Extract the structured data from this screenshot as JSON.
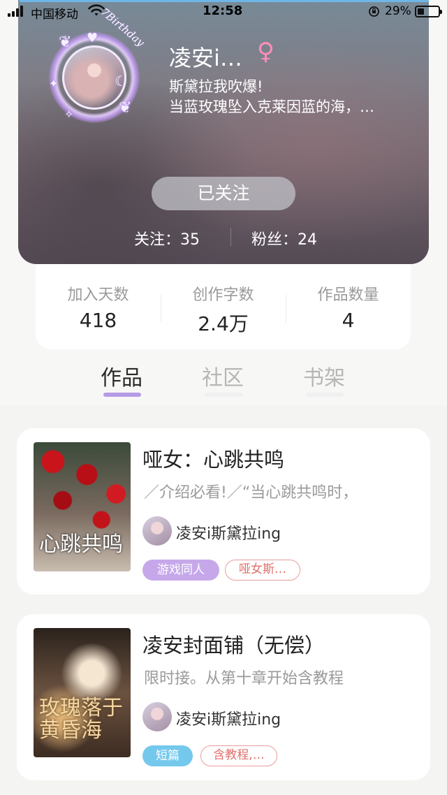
{
  "status_bar": {
    "carrier": "中国移动",
    "time": "12:58",
    "battery": "29%"
  },
  "profile": {
    "avatar_badge": "7Birthday",
    "username": "凌安i…",
    "gender_symbol": "♀",
    "bio_line1": "斯黛拉我吹爆!",
    "bio_line2": "当蓝玫瑰坠入克莱因蓝的海，…",
    "follow_button": "已关注",
    "following": "关注：35",
    "fans": "粉丝：24"
  },
  "stats": [
    {
      "label": "加入天数",
      "value": "418"
    },
    {
      "label": "创作字数",
      "value": "2.4万"
    },
    {
      "label": "作品数量",
      "value": "4"
    }
  ],
  "tabs": [
    {
      "label": "作品",
      "active": true
    },
    {
      "label": "社区",
      "active": false
    },
    {
      "label": "书架",
      "active": false
    }
  ],
  "works": [
    {
      "title": "哑女：心跳共鸣",
      "description": "／介绍必看!／“当心跳共鸣时，",
      "author": "凌安i斯黛拉ing",
      "cover_text": "心跳共鸣",
      "tags": [
        {
          "label": "游戏同人",
          "style": "fill-purple"
        },
        {
          "label": "哑女斯…",
          "style": "outline"
        }
      ]
    },
    {
      "title": "凌安封面铺（无偿）",
      "description": "限时接。从第十章开始含教程",
      "author": "凌安i斯黛拉ing",
      "cover_text": "玫瑰落于黄昏海",
      "tags": [
        {
          "label": "短篇",
          "style": "fill-blue"
        },
        {
          "label": "含教程,…",
          "style": "outline"
        }
      ]
    }
  ],
  "colors": {
    "accent": "#b59be6",
    "tag_purple": "#c6a8ea",
    "tag_blue": "#74c8ec",
    "tag_outline": "#e59e9a",
    "gender": "#ff8fb8"
  }
}
